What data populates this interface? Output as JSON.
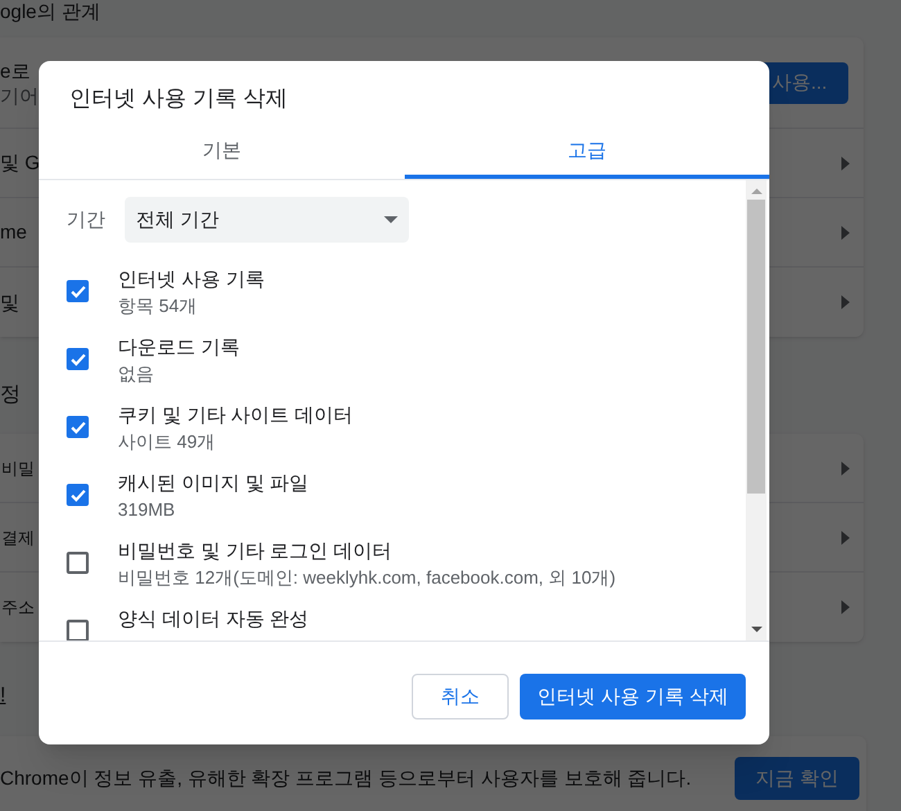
{
  "background": {
    "heading": "ogle의 관계",
    "card_1": {
      "row_1": {
        "text_1": "e로",
        "text_2": "기어",
        "button": "사용..."
      },
      "rows": [
        {
          "text": "및 G"
        },
        {
          "text": "me"
        },
        {
          "text": "및"
        }
      ]
    },
    "section_heading": "정",
    "card_2": {
      "rows": [
        {
          "text": "비밀"
        },
        {
          "text": "결제"
        },
        {
          "text": "주소"
        }
      ]
    },
    "link": "!",
    "card_3": {
      "text": "Chrome이 정보 유출, 유해한 확장 프로그램 등으로부터 사용자를 보호해 줍니다.",
      "button": "지금 확인"
    }
  },
  "dialog": {
    "title": "인터넷 사용 기록 삭제",
    "tabs": [
      {
        "label": "기본",
        "selected": false
      },
      {
        "label": "고급",
        "selected": true
      }
    ],
    "period": {
      "label": "기간",
      "value": "전체 기간"
    },
    "items": [
      {
        "title": "인터넷 사용 기록",
        "detail": "항목 54개",
        "checked": true
      },
      {
        "title": "다운로드 기록",
        "detail": "없음",
        "checked": true
      },
      {
        "title": "쿠키 및 기타 사이트 데이터",
        "detail": "사이트 49개",
        "checked": true
      },
      {
        "title": "캐시된 이미지 및 파일",
        "detail": "319MB",
        "checked": true
      },
      {
        "title": "비밀번호 및 기타 로그인 데이터",
        "detail": "비밀번호 12개(도메인: weeklyhk.com, facebook.com, 외 10개)",
        "checked": false
      },
      {
        "title": "양식 데이터 자동 완성",
        "checked": false
      }
    ],
    "buttons": {
      "cancel": "취소",
      "confirm": "인터넷 사용 기록 삭제"
    }
  }
}
